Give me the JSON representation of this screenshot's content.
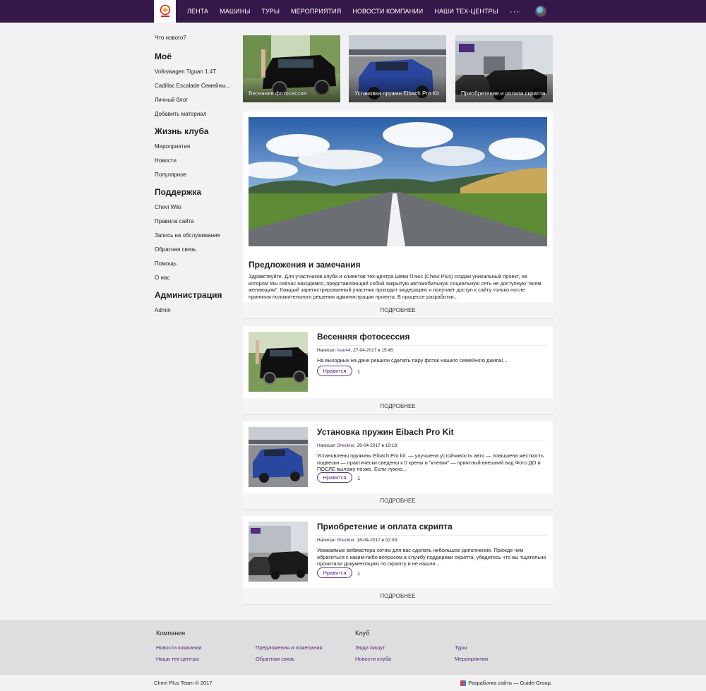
{
  "colors": {
    "topbar": "#35174a",
    "accent": "#4a2c80"
  },
  "nav": {
    "items": [
      "ЛЕНТА",
      "МАШИНЫ",
      "ТУРЫ",
      "МЕРОПРИЯТИЯ",
      "НОВОСТИ КОМПАНИИ",
      "НАШИ ТЕХ-ЦЕНТРЫ"
    ],
    "more": "···"
  },
  "sidebar": {
    "whats_new": "Что нового?",
    "sections": [
      {
        "title": "Моё",
        "items": [
          "Volkswagen Tiguan 1.4T",
          "Cadillac Escalade Семейны...",
          "Личный блог",
          "Добавить материал"
        ]
      },
      {
        "title": "Жизнь клуба",
        "items": [
          "Мероприятия",
          "Новости",
          "Популярное"
        ]
      },
      {
        "title": "Поддержка",
        "items": [
          "Chevi Wiki",
          "Правила сайта",
          "Запись на обслуживание",
          "Обратная связь",
          "Помощь",
          "О нас"
        ]
      },
      {
        "title": "Администрация",
        "items": [
          "Admin"
        ]
      }
    ]
  },
  "thumbs": [
    {
      "caption": "Весенняя фотосессия"
    },
    {
      "caption": "Установка пружин Eibach Pro Kit"
    },
    {
      "caption": "Приобретение и оплата скрипта"
    }
  ],
  "featured": {
    "title": "Предложения и замечания",
    "text": "Здравствуйте, Для участников клуба и клиентов тех-центра Шеви Плюс (Chevi Plus) создан уникальный проект, на котором Мы сейчас находимся, представляющий собой закрытую автомобильную социальную сеть не доступную \"всем желающим\". Каждый зарегистрированный участник проходит модерацию и получает доступ к сайту только после принятия положительного решения администрации проекта. В процессе разработки...",
    "more": "ПОДРОБНЕЕ"
  },
  "posts": [
    {
      "title": "Весенняя фотосессия",
      "meta_prefix": "Написал ",
      "author": "Ivan44",
      "date": ", 27-04-2017 в 15:45:",
      "text": "На выходных на даче решили сделать пару фоток нашего семейного джипа!...",
      "like": "Нравится",
      "likes": "1",
      "more": "ПОДРОБНЕЕ"
    },
    {
      "title": "Установка пружин Eibach Pro Kit",
      "meta_prefix": "Написал ",
      "author": "Sheckler",
      "date": ", 26-04-2017 в 19:18:",
      "text": "Установлены пружины Eibach Pro kit: — улучшена устойчивость авто — повышена жесткость подвески — практически сведены к 0 крены и \"клевки\" — приятный внешний вид Фото ДО и ПОСЛЕ выложу позже. Если нужно...",
      "like": "Нравится",
      "likes": "1",
      "more": "ПОДРОБНЕЕ"
    },
    {
      "title": "Приобретение и оплата скрипта",
      "meta_prefix": "Написал ",
      "author": "Sheckler",
      "date": ", 18-04-2017 в 02:09:",
      "text": "Уважаемые вебмастера хотим для вас сделать небольшое дополнение. Прежде чем обратиться с каким-либо вопросом в службу поддержки скрипта, убедитесь что вы тщательно прочитали документацию по скрипту и не нашли...",
      "like": "Нравится",
      "likes": "1",
      "more": "ПОДРОБНЕЕ"
    }
  ],
  "footer": {
    "company_title": "Компания",
    "club_title": "Клуб",
    "company_links": [
      "Новости компании",
      "Наши тех-центры",
      "Предложения и пожелания",
      "Обратная связь"
    ],
    "club_links": [
      "Люди пишут",
      "Новости клуба",
      "Туры",
      "Мероприятия"
    ],
    "copyright": "Chevi Plus Team © 2017",
    "developer": "Разработка сайта — Guide-Group."
  }
}
